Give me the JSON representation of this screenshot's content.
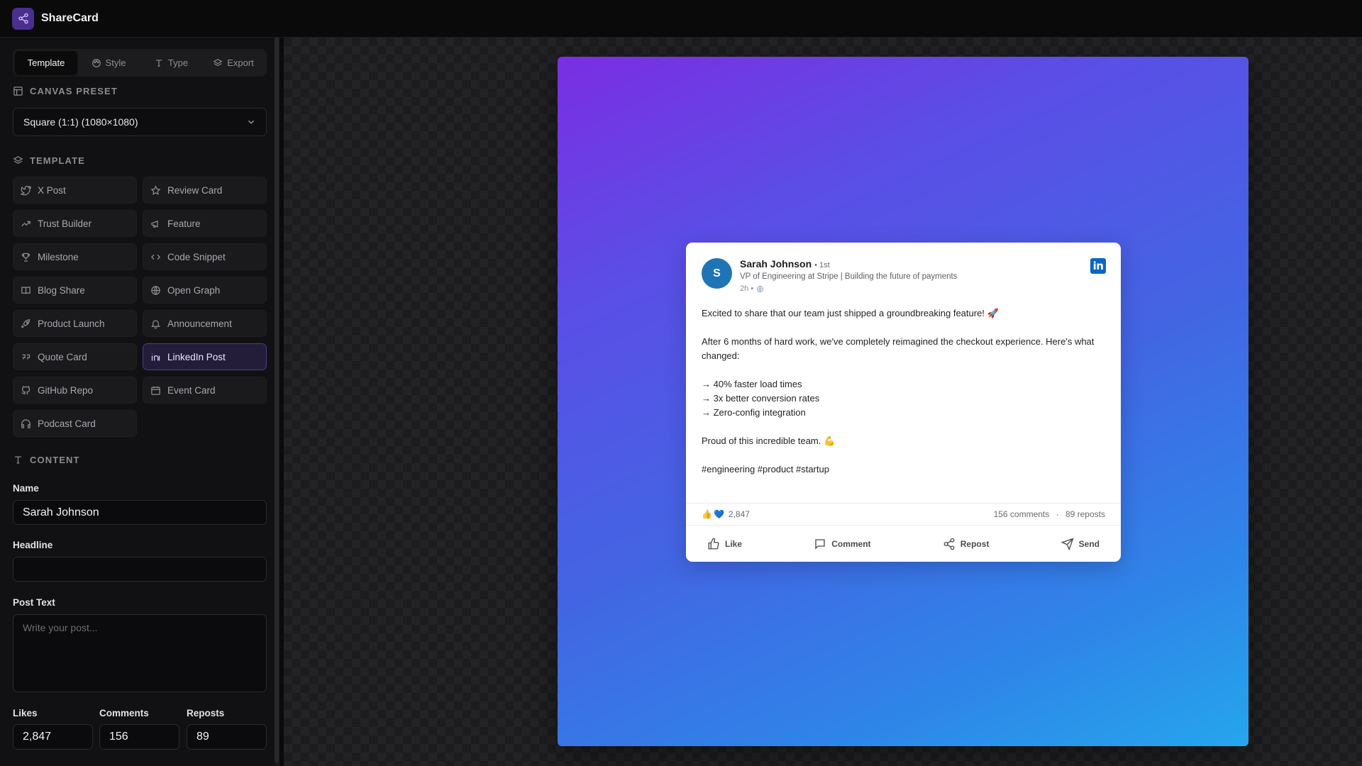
{
  "app": {
    "title": "ShareCard"
  },
  "tabs": [
    {
      "label": "Template",
      "icon": "layout-icon"
    },
    {
      "label": "Style",
      "icon": "palette-icon"
    },
    {
      "label": "Type",
      "icon": "type-icon"
    },
    {
      "label": "Export",
      "icon": "layers-icon"
    }
  ],
  "canvas_preset": {
    "heading": "CANVAS PRESET",
    "selected": "Square (1:1) (1080×1080)"
  },
  "template": {
    "heading": "TEMPLATE",
    "items": [
      {
        "label": "X Post",
        "icon": "bird-icon"
      },
      {
        "label": "Review Card",
        "icon": "star-icon"
      },
      {
        "label": "Trust Builder",
        "icon": "trend-icon"
      },
      {
        "label": "Feature",
        "icon": "megaphone-icon"
      },
      {
        "label": "Milestone",
        "icon": "trophy-icon"
      },
      {
        "label": "Code Snippet",
        "icon": "code-icon"
      },
      {
        "label": "Blog Share",
        "icon": "book-icon"
      },
      {
        "label": "Open Graph",
        "icon": "globe-icon"
      },
      {
        "label": "Product Launch",
        "icon": "rocket-icon"
      },
      {
        "label": "Announcement",
        "icon": "bell-icon"
      },
      {
        "label": "Quote Card",
        "icon": "quote-icon"
      },
      {
        "label": "LinkedIn Post",
        "icon": "linkedin-icon"
      },
      {
        "label": "GitHub Repo",
        "icon": "github-icon"
      },
      {
        "label": "Event Card",
        "icon": "calendar-icon"
      },
      {
        "label": "Podcast Card",
        "icon": "headphones-icon"
      }
    ],
    "active": "LinkedIn Post"
  },
  "content": {
    "heading": "CONTENT",
    "name_label": "Name",
    "name_value": "Sarah Johnson",
    "headline_label": "Headline",
    "headline_value": "",
    "post_text_label": "Post Text",
    "post_text_placeholder": "Write your post...",
    "likes_label": "Likes",
    "likes_value": "2,847",
    "comments_label": "Comments",
    "comments_value": "156",
    "reposts_label": "Reposts",
    "reposts_value": "89"
  },
  "post": {
    "avatar_initial": "S",
    "name": "Sarah Johnson",
    "degree": "• 1st",
    "headline": "VP of Engineering at Stripe | Building the future of payments",
    "time": "2h •",
    "body": [
      "Excited to share that our team just shipped a groundbreaking feature! 🚀",
      "",
      "After 6 months of hard work, we've completely reimagined the checkout experience. Here's what changed:",
      "",
      "→ 40% faster load times",
      "→ 3x better conversion rates",
      "→ Zero-config integration",
      "",
      "Proud of this incredible team. 💪",
      "",
      "#engineering #product #startup"
    ],
    "likes": "2,847",
    "comments": "156 comments",
    "reposts": "89 reposts",
    "actions": {
      "like": "Like",
      "comment": "Comment",
      "repost": "Repost",
      "send": "Send"
    }
  },
  "colors": {
    "accent": "#4b3b8a",
    "linkedin": "#0a66c2",
    "gradient_start": "#7a2ee3",
    "gradient_end": "#25a6ec"
  }
}
